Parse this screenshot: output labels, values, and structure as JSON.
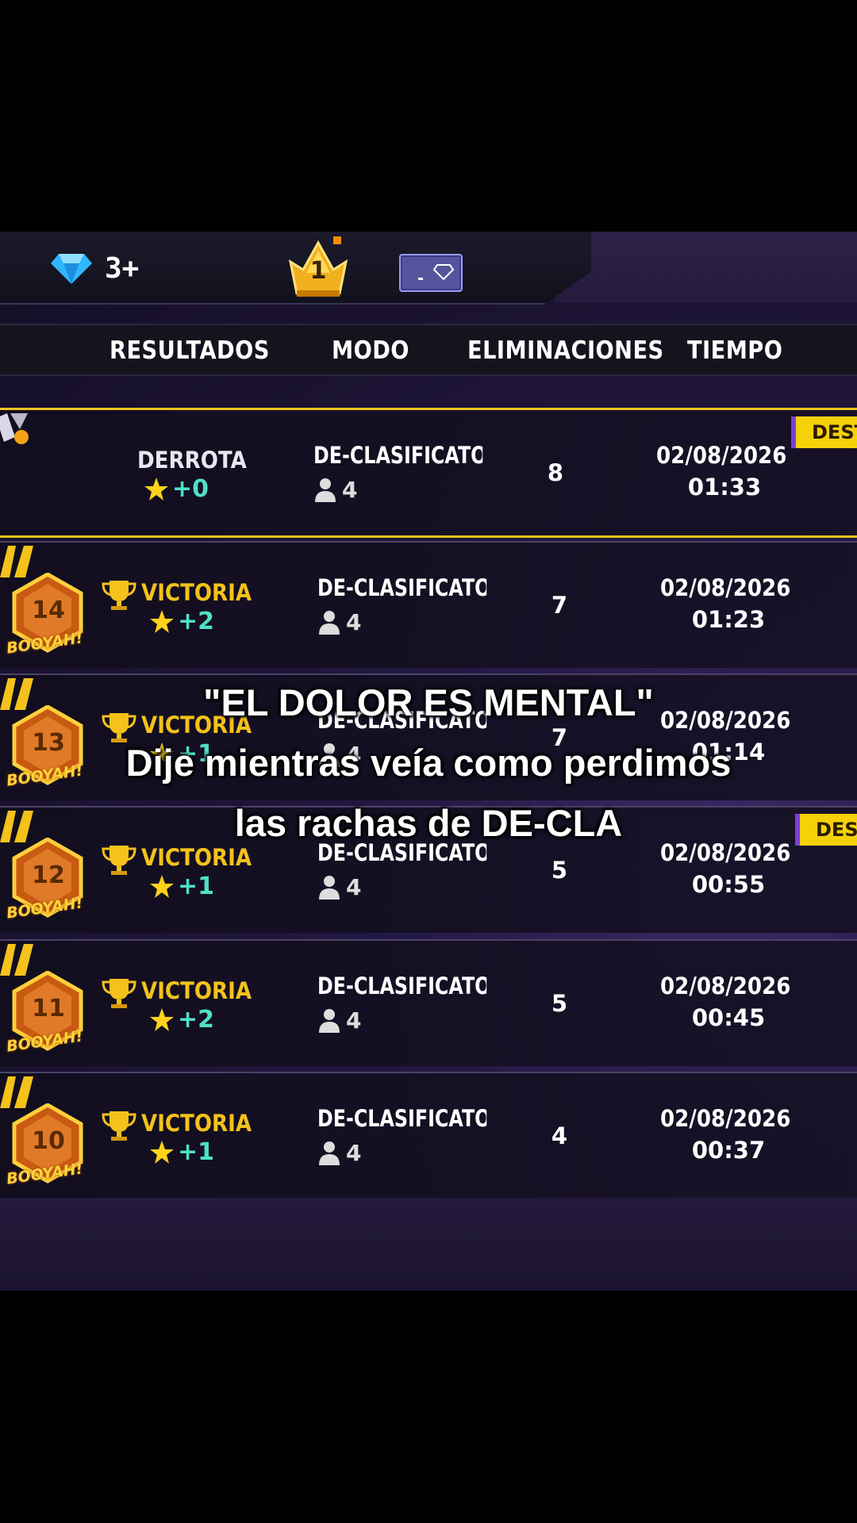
{
  "topbar": {
    "diamond_count": "3+",
    "rank_badge": "1"
  },
  "columns": {
    "results": "RESULTADOS",
    "mode": "MODO",
    "eliminations": "ELIMINACIONES",
    "time": "TIEMPO"
  },
  "rows": [
    {
      "result": "DERROTA",
      "points": "+0",
      "mode": "DE-CLASIFICATOF",
      "players": "4",
      "kills": "8",
      "date": "02/08/2026",
      "time": "01:33",
      "streak": "",
      "tag": "DEST"
    },
    {
      "result": "VICTORIA",
      "points": "+2",
      "mode": "DE-CLASIFICATOF",
      "players": "4",
      "kills": "7",
      "date": "02/08/2026",
      "time": "01:23",
      "streak": "14",
      "tag": ""
    },
    {
      "result": "VICTORIA",
      "points": "+1",
      "mode": "DE-CLASIFICATOF",
      "players": "4",
      "kills": "7",
      "date": "02/08/2026",
      "time": "01:14",
      "streak": "13",
      "tag": ""
    },
    {
      "result": "VICTORIA",
      "points": "+1",
      "mode": "DE-CLASIFICATOF",
      "players": "4",
      "kills": "5",
      "date": "02/08/2026",
      "time": "00:55",
      "streak": "12",
      "tag": "DEST"
    },
    {
      "result": "VICTORIA",
      "points": "+2",
      "mode": "DE-CLASIFICATOF",
      "players": "4",
      "kills": "5",
      "date": "02/08/2026",
      "time": "00:45",
      "streak": "11",
      "tag": ""
    },
    {
      "result": "VICTORIA",
      "points": "+1",
      "mode": "DE-CLASIFICATOF",
      "players": "4",
      "kills": "4",
      "date": "02/08/2026",
      "time": "00:37",
      "streak": "10",
      "tag": ""
    }
  ],
  "booyah_label": "BOOYAH!",
  "caption": {
    "line1": "\"EL DOLOR ES MENTAL\"",
    "line2": "Dije mientras veía como perdimos",
    "line3": "las rachas de DE-CLA"
  },
  "colors": {
    "accent_gold": "#f4c21a",
    "points_teal": "#4fe0c8",
    "highlight_border": "#f0c419"
  }
}
